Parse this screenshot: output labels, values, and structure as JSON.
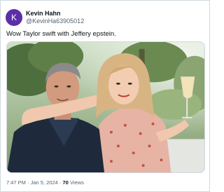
{
  "author": {
    "avatar_letter": "K",
    "name": "Kevin Hahn",
    "handle": "@KevinHa63905012"
  },
  "tweet": {
    "text": "Wow Taylor swift with Jeffery  epstein."
  },
  "meta": {
    "time": "7:47 PM",
    "separator": "·",
    "date": "Jan 5, 2024",
    "views_count": "70",
    "views_label": "Views"
  },
  "colors": {
    "avatar_bg": "#5b2fa8",
    "text_primary": "#0f1419",
    "text_secondary": "#536471"
  }
}
